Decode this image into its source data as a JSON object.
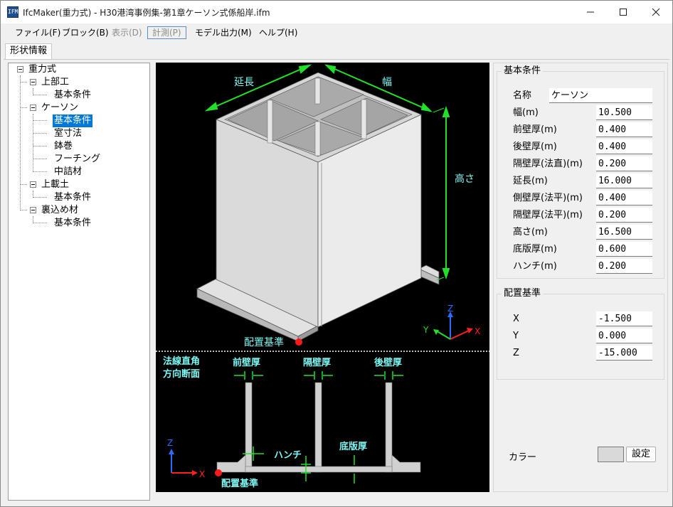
{
  "window": {
    "title": "IfcMaker(重力式) - H30港湾事例集-第1章ケーソン式係船岸.ifm",
    "app_icon_text": "IFM",
    "controls": [
      "minimize-icon",
      "maximize-icon",
      "close-icon"
    ]
  },
  "menu": {
    "items": [
      {
        "label": "ファイル(F)",
        "state": "enabled"
      },
      {
        "label": "ブロック(B)",
        "state": "enabled"
      },
      {
        "label": "表示(D)",
        "state": "disabled"
      },
      {
        "label": "計測(P)",
        "state": "disabled-boxed"
      },
      {
        "label": "モデル出力(M)",
        "state": "enabled"
      },
      {
        "label": "ヘルプ(H)",
        "state": "enabled"
      }
    ]
  },
  "tabs": {
    "active": "形状情報"
  },
  "tree": {
    "root": "重力式",
    "nodes": [
      {
        "label": "上部工",
        "children": [
          "基本条件"
        ]
      },
      {
        "label": "ケーソン",
        "children": [
          "基本条件",
          "室寸法",
          "鉢巻",
          "フーチング",
          "中詰材"
        ]
      },
      {
        "label": "上載土",
        "children": [
          "基本条件"
        ]
      },
      {
        "label": "裏込め材",
        "children": [
          "基本条件"
        ]
      }
    ],
    "selected": "ケーソン/基本条件"
  },
  "viewport": {
    "labels": {
      "length": "延長",
      "width": "幅",
      "height": "高さ",
      "origin": "配置基準",
      "section_title_1": "法線直角",
      "section_title_2": "方向断面",
      "front_wall": "前壁厚",
      "partition_wall": "隔壁厚",
      "rear_wall": "後壁厚",
      "haunch": "ハンチ",
      "base_thickness": "底版厚",
      "origin_bottom": "配置基準",
      "axis_x": "X",
      "axis_y": "Y",
      "axis_z": "Z",
      "axis2_x": "X",
      "axis2_z": "Z"
    },
    "colors": {
      "background": "#000000",
      "dimension": "#22e02a",
      "label": "#7ef7f2",
      "origin": "#ff1a1a",
      "axis_x": "#ff2020",
      "axis_y": "#22e02a",
      "axis_z": "#2a6cff"
    }
  },
  "basic_conditions": {
    "title": "基本条件",
    "fields": [
      {
        "label": "名称",
        "value": "ケーソン"
      },
      {
        "label": "幅(m)",
        "value": "10.500"
      },
      {
        "label": "前壁厚(m)",
        "value": "0.400"
      },
      {
        "label": "後壁厚(m)",
        "value": "0.400"
      },
      {
        "label": "隔壁厚(法直)(m)",
        "value": "0.200"
      },
      {
        "label": "延長(m)",
        "value": "16.000"
      },
      {
        "label": "側壁厚(法平)(m)",
        "value": "0.400"
      },
      {
        "label": "隔壁厚(法平)(m)",
        "value": "0.200"
      },
      {
        "label": "高さ(m)",
        "value": "16.500"
      },
      {
        "label": "底版厚(m)",
        "value": "0.600"
      },
      {
        "label": "ハンチ(m)",
        "value": "0.200"
      }
    ]
  },
  "placement": {
    "title": "配置基準",
    "fields": [
      {
        "label": "X",
        "value": "-1.500"
      },
      {
        "label": "Y",
        "value": "0.000"
      },
      {
        "label": "Z",
        "value": "-15.000"
      }
    ]
  },
  "color_setting": {
    "label": "カラー",
    "swatch": "#d9d9d9",
    "button": "設定"
  }
}
